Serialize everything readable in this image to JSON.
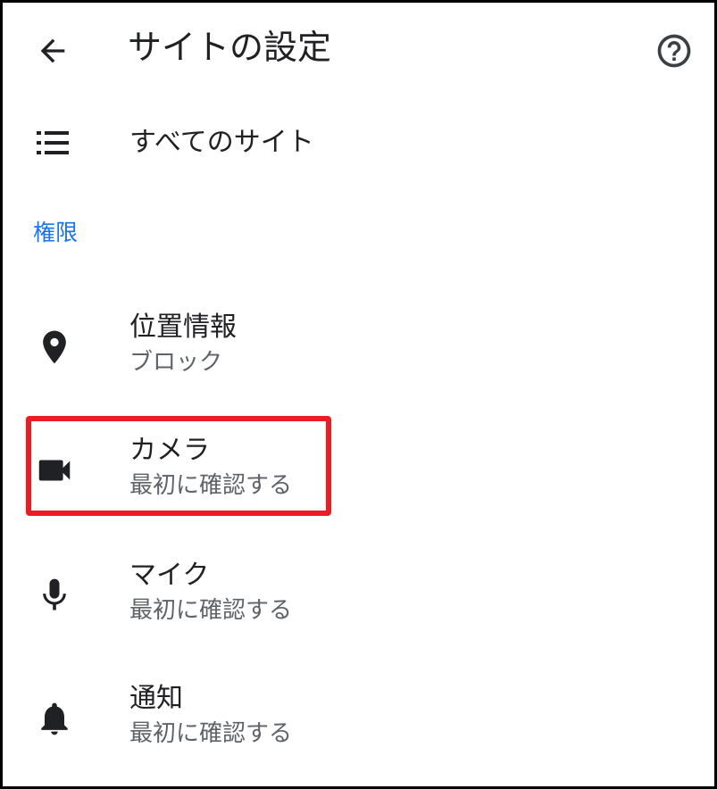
{
  "header": {
    "title": "サイトの設定",
    "back_icon": "arrow-back-icon",
    "help_icon": "help-circle-icon"
  },
  "all_sites": {
    "label": "すべてのサイト",
    "icon": "list-icon"
  },
  "section": {
    "label": "権限"
  },
  "permissions": [
    {
      "title": "位置情報",
      "status": "ブロック",
      "icon": "location-pin-icon"
    },
    {
      "title": "カメラ",
      "status": "最初に確認する",
      "icon": "videocam-icon"
    },
    {
      "title": "マイク",
      "status": "最初に確認する",
      "icon": "mic-icon"
    },
    {
      "title": "通知",
      "status": "最初に確認する",
      "icon": "bell-icon"
    }
  ],
  "colors": {
    "accent": "#1a73e8",
    "text_primary": "#202124",
    "text_secondary": "#5f6368",
    "highlight": "#ec1c24"
  }
}
